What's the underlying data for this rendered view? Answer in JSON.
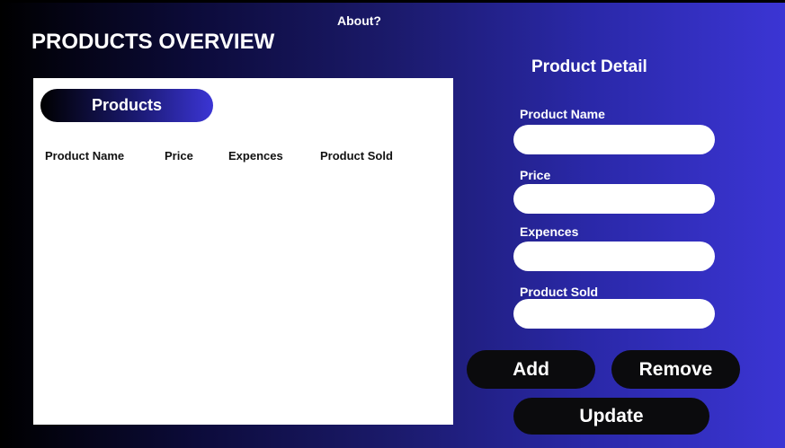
{
  "header": {
    "about_link": "About?",
    "title": "PRODUCTS OVERVIEW"
  },
  "products": {
    "pill_label": "Products",
    "columns": [
      "Product Name",
      "Price",
      "Expences",
      "Product Sold"
    ]
  },
  "detail": {
    "title": "Product Detail",
    "fields": {
      "name": {
        "label": "Product Name",
        "value": "",
        "placeholder": ""
      },
      "price": {
        "label": "Price",
        "value": "",
        "placeholder": ""
      },
      "expences": {
        "label": "Expences",
        "value": "",
        "placeholder": ""
      },
      "sold": {
        "label": "Product Sold",
        "value": "",
        "placeholder": ""
      }
    }
  },
  "actions": {
    "add_label": "Add",
    "remove_label": "Remove",
    "update_label": "Update"
  }
}
